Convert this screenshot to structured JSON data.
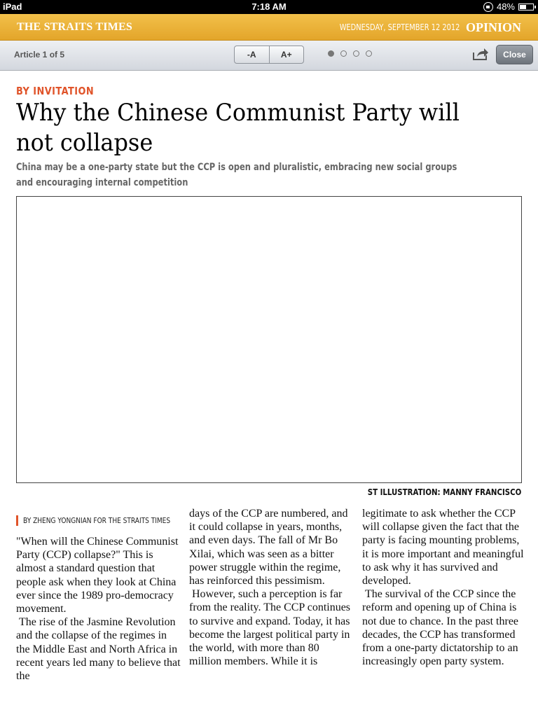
{
  "status_bar": {
    "device": "iPad",
    "time": "7:18 AM",
    "battery_text": "48%",
    "battery_level": 0.48
  },
  "masthead": {
    "brand": "THE STRAITS TIMES",
    "date": "WEDNESDAY, SEPTEMBER 12 2012",
    "section": "OPINION",
    "color": "#e9b032"
  },
  "toolbar": {
    "article_count": "Article 1 of 5",
    "font_decrease": "-A",
    "font_increase": "A+",
    "page_dots": 4,
    "active_dot": 0,
    "share_icon": "share-icon",
    "close_label": "Close"
  },
  "article": {
    "kicker": "BY INVITATION",
    "kicker_color": "#e0542a",
    "headline": "Why the Chinese Communist Party will not collapse",
    "standfirst": "China may be a one-party state but the CCP is open and pluralistic, embracing new social groups and encouraging internal competition",
    "image_credit": "ST ILLUSTRATION: MANNY FRANCISCO",
    "byline": "BY ZHENG YONGNIAN FOR THE STRAITS TIMES",
    "columns": [
      {
        "paragraphs": [
          "\"When will the Chinese Communist Party (CCP) collapse?\" This is almost a standard question that people ask when they look at China ever since the 1989 pro-democracy movement.",
          "The rise of the Jasmine Revolution and the collapse of the regimes in the Middle East and North Africa in recent years led many to believe that the"
        ]
      },
      {
        "paragraphs": [
          "days of the CCP are numbered, and it could collapse in years, months, and even days. The fall of Mr Bo Xilai, which was seen as a bitter power struggle within the regime, has reinforced this pessimism.",
          "However, such a perception is far from the reality. The CCP continues to survive and expand. Today, it has become the largest political party in the world, with more than 80 million members. While it is"
        ]
      },
      {
        "paragraphs": [
          "legitimate to ask whether the CCP will collapse given the fact that the party is facing mounting problems, it is more important and meaningful to ask why it has survived and developed.",
          "The survival of the CCP since the reform and opening up of China is not due to chance. In the past three decades, the CCP has transformed from a one-party dictatorship to an increasingly open party system."
        ]
      }
    ]
  }
}
